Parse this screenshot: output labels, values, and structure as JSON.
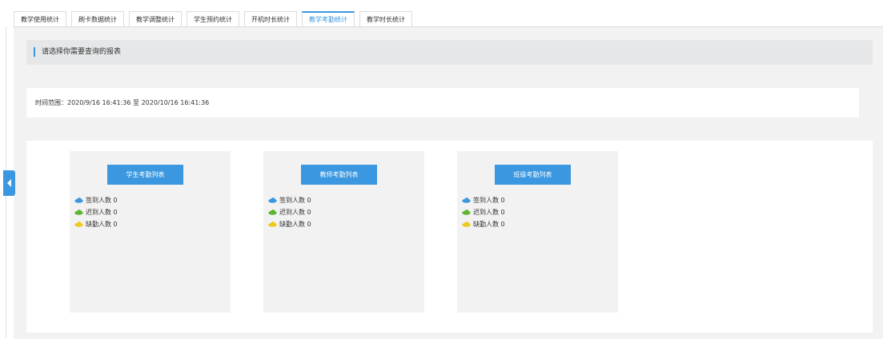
{
  "tabs": [
    {
      "label": "教学使用统计",
      "active": false
    },
    {
      "label": "刷卡数据统计",
      "active": false
    },
    {
      "label": "教学调整统计",
      "active": false
    },
    {
      "label": "学生预约统计",
      "active": false
    },
    {
      "label": "开机时长统计",
      "active": false
    },
    {
      "label": "教学考勤统计",
      "active": true
    },
    {
      "label": "教学时长统计",
      "active": false
    }
  ],
  "header": {
    "title": "请选择你需要查询的报表"
  },
  "time_range": {
    "text": "时间范围：2020/9/16 16:41:36 至 2020/10/16 16:41:36"
  },
  "colors": {
    "accent": "#3a97e0",
    "checkin": "#3a97e0",
    "late": "#5cb531",
    "absent": "#ecc91c"
  },
  "cards": [
    {
      "button": "学生考勤列表",
      "stats": [
        {
          "icon": "blue-cloud-icon",
          "label": "签到人数",
          "value": "0"
        },
        {
          "icon": "green-cloud-icon",
          "label": "迟到人数",
          "value": "0"
        },
        {
          "icon": "yellow-cloud-icon",
          "label": "缺勤人数",
          "value": "0"
        }
      ]
    },
    {
      "button": "教师考勤列表",
      "stats": [
        {
          "icon": "blue-cloud-icon",
          "label": "签到人数",
          "value": "0"
        },
        {
          "icon": "green-cloud-icon",
          "label": "迟到人数",
          "value": "0"
        },
        {
          "icon": "yellow-cloud-icon",
          "label": "缺勤人数",
          "value": "0"
        }
      ]
    },
    {
      "button": "班级考勤列表",
      "stats": [
        {
          "icon": "blue-cloud-icon",
          "label": "签到人数",
          "value": "0"
        },
        {
          "icon": "green-cloud-icon",
          "label": "迟到人数",
          "value": "0"
        },
        {
          "icon": "yellow-cloud-icon",
          "label": "缺勤人数",
          "value": "0"
        }
      ]
    }
  ]
}
